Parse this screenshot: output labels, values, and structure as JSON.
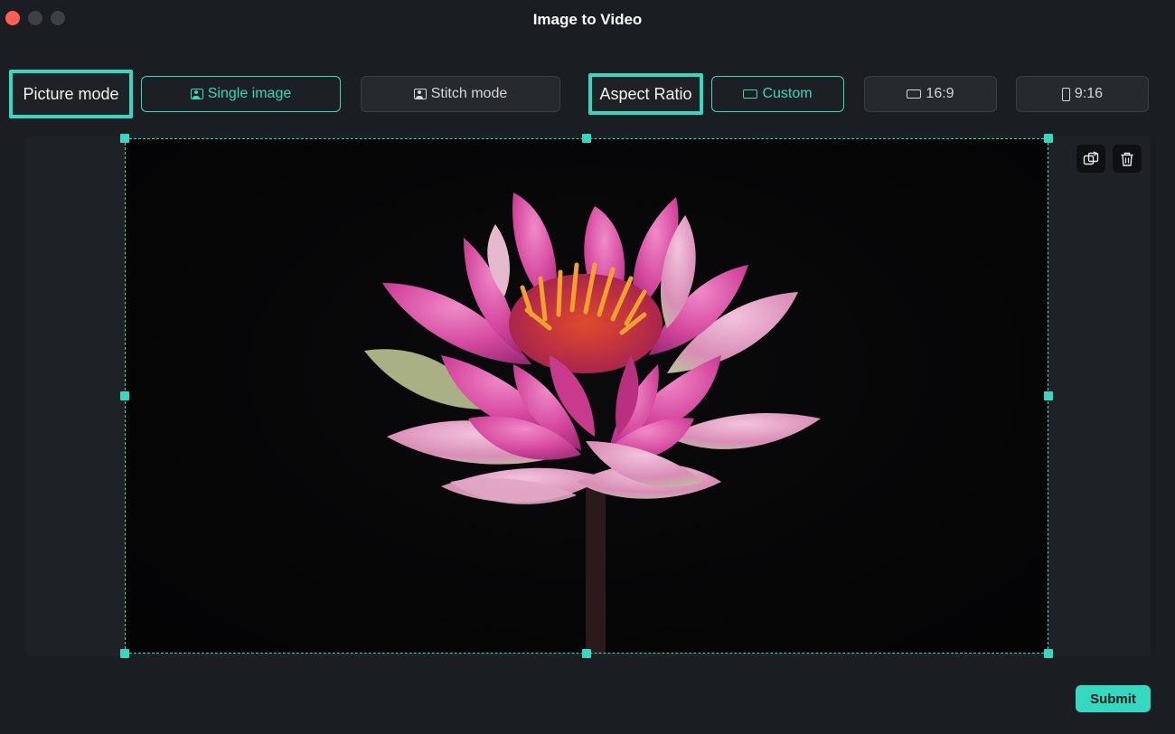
{
  "window": {
    "title": "Image to Video"
  },
  "toolbar": {
    "picture_mode_label": "Picture mode",
    "single_image_label": "Single image",
    "stitch_mode_label": "Stitch mode",
    "aspect_ratio_label": "Aspect Ratio",
    "custom_label": "Custom",
    "ratio_16_9_label": "16:9",
    "ratio_9_16_label": "9:16",
    "selected_picture_mode": "Single image",
    "selected_aspect_ratio": "Custom"
  },
  "canvas": {
    "image_subject": "pink water lily on black background",
    "tools": [
      {
        "name": "replace",
        "icon": "replace-image-icon"
      },
      {
        "name": "delete",
        "icon": "trash-icon"
      }
    ]
  },
  "footer": {
    "submit_label": "Submit"
  },
  "colors": {
    "accent": "#35d9c1",
    "background": "#1a1d21",
    "close_light": "#ff5f57"
  }
}
